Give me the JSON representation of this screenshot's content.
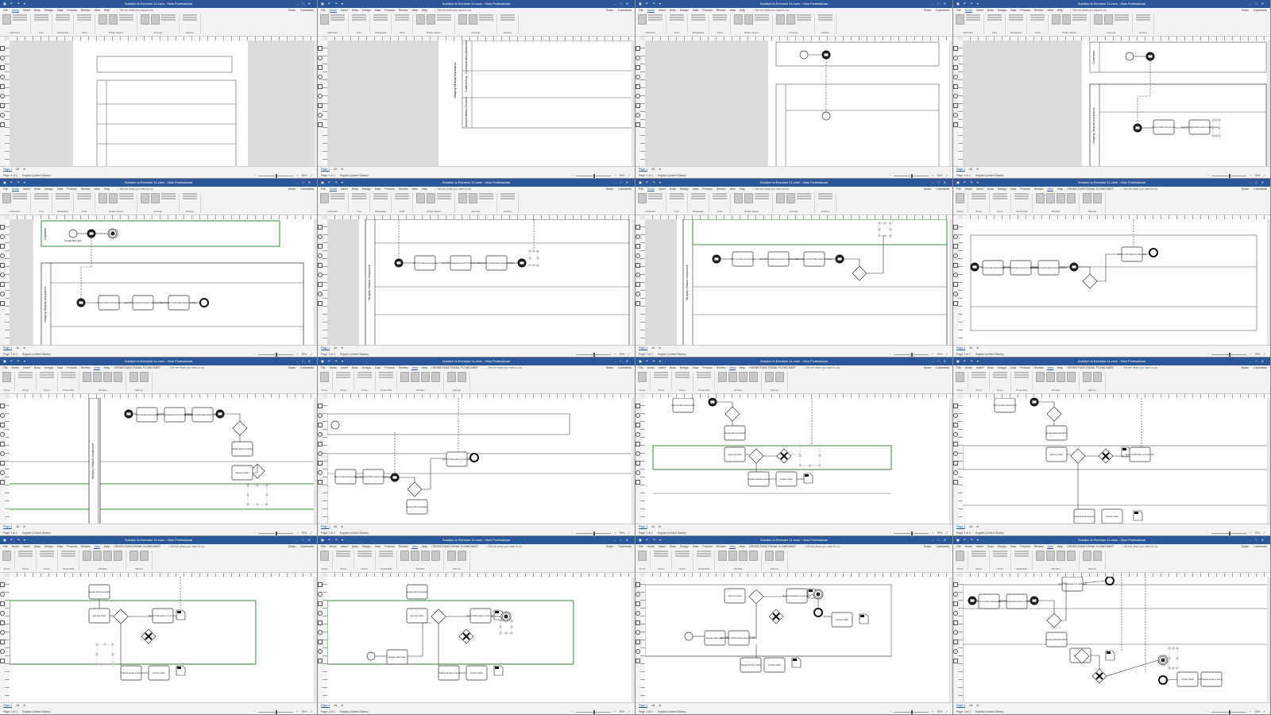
{
  "app": {
    "title": "Solution to Exercise 11.vsdx  -  Visio Professional",
    "tab_search": "Tell me what you want to do",
    "share_label": "Share",
    "comments_label": "Comments",
    "shape_data_title": "CROSS-FUNCTIONAL FLOWCHART",
    "page_tab": "Page-1",
    "all_tab": "All",
    "status_page": "Page 1 of 1",
    "status_lang": "English (United States)",
    "zoom_label": "76%"
  },
  "menus": {
    "home": [
      "File",
      "Home",
      "Insert",
      "Draw",
      "Design",
      "Data",
      "Process",
      "Review",
      "View",
      "Help"
    ],
    "view": [
      "File",
      "Home",
      "Insert",
      "Draw",
      "Design",
      "Data",
      "Process",
      "Review",
      "View",
      "Help",
      "CROSS-FUNCTIONAL FLOWCHART"
    ]
  },
  "ribbons": {
    "home": [
      {
        "label": "Clipboard",
        "big": 1,
        "small": 3
      },
      {
        "label": "Font",
        "big": 0,
        "small": 3
      },
      {
        "label": "Paragraph",
        "big": 0,
        "small": 3
      },
      {
        "label": "Tools",
        "big": 0,
        "small": 3
      },
      {
        "label": "Shape Styles",
        "big": 2,
        "small": 3
      },
      {
        "label": "Arrange",
        "big": 2,
        "small": 3
      },
      {
        "label": "Editing",
        "big": 0,
        "small": 3
      }
    ],
    "view": [
      {
        "label": "Views",
        "big": 1,
        "small": 0
      },
      {
        "label": "Show",
        "big": 0,
        "small": 3
      },
      {
        "label": "Zoom",
        "big": 0,
        "small": 3
      },
      {
        "label": "Visual Aids",
        "big": 0,
        "small": 3
      },
      {
        "label": "Window",
        "big": 4,
        "small": 0
      },
      {
        "label": "Macros",
        "big": 2,
        "small": 0
      }
    ]
  },
  "lane_labels": {
    "pool": "Murphy Mutual Insurance",
    "customer": "Customer",
    "office_manager": "Office Manager",
    "comm_admin": "Communication Administration",
    "underwriting": "Underwriting",
    "doc_services": "Documentation Services"
  },
  "task_labels": {
    "prepare_claim": "Prepare New Claim",
    "scan_index": "Scan & Index Documents",
    "send_physical": "Send Physical Documents to Warehouse",
    "materialize": "Materialize Confirmation Documentation",
    "send_confirmation": "Send Confirmation to Customer",
    "approve": "Approve Claim",
    "review": "Review Documentation",
    "finance_docs": "Prepare Finance Docs",
    "archive": "Archive Claim"
  },
  "panels": [
    {
      "ribbon": "home",
      "variant": "pool_outline"
    },
    {
      "ribbon": "home",
      "variant": "lanes_labels"
    },
    {
      "ribbon": "home",
      "variant": "customer_start"
    },
    {
      "ribbon": "home",
      "variant": "first_tasks"
    },
    {
      "ribbon": "home",
      "variant": "full_top"
    },
    {
      "ribbon": "home",
      "variant": "tasks_message"
    },
    {
      "ribbon": "home",
      "variant": "gateway_added"
    },
    {
      "ribbon": "view",
      "variant": "end_event"
    },
    {
      "ribbon": "view",
      "variant": "underwriting_flow"
    },
    {
      "ribbon": "view",
      "variant": "mid_overview"
    },
    {
      "ribbon": "view",
      "variant": "x_gateway"
    },
    {
      "ribbon": "view",
      "variant": "x_gateway_b"
    },
    {
      "ribbon": "view",
      "variant": "lower_flow"
    },
    {
      "ribbon": "view",
      "variant": "lower_flow_b"
    },
    {
      "ribbon": "view",
      "variant": "lower_flow_c"
    },
    {
      "ribbon": "view",
      "variant": "complete"
    }
  ]
}
